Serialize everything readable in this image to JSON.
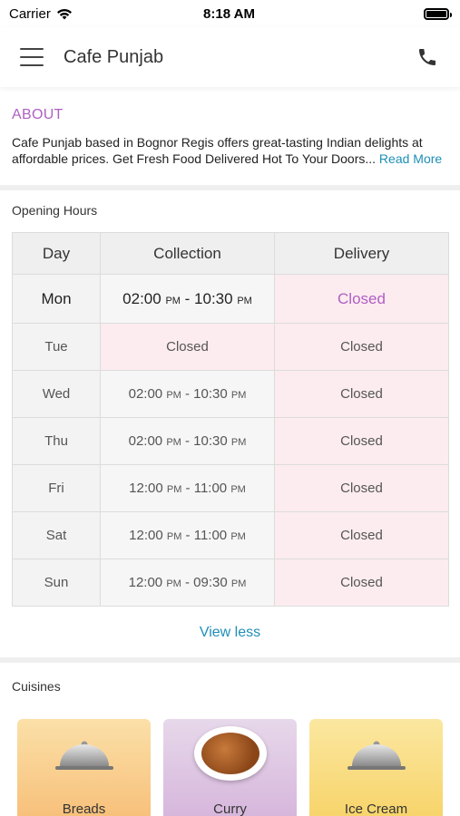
{
  "status_bar": {
    "carrier": "Carrier",
    "time": "8:18 AM"
  },
  "header": {
    "title": "Cafe Punjab"
  },
  "about": {
    "title": "ABOUT",
    "text_line1": "Cafe Punjab based in Bognor Regis offers great-tasting Indian delights at",
    "text_line2": "affordable prices. Get Fresh Food Delivered Hot To Your Doors...",
    "read_more": "Read More"
  },
  "hours": {
    "title": "Opening Hours",
    "columns": [
      "Day",
      "Collection",
      "Delivery"
    ],
    "rows": [
      {
        "day": "Mon",
        "collection": "02:00 PM - 10:30 PM",
        "c_start": "02:00",
        "c_end": "10:30",
        "c_closed": false,
        "delivery": "Closed",
        "today": true
      },
      {
        "day": "Tue",
        "collection": "Closed",
        "c_closed": true,
        "delivery": "Closed"
      },
      {
        "day": "Wed",
        "collection": "02:00 PM - 10:30 PM",
        "c_start": "02:00",
        "c_end": "10:30",
        "c_closed": false,
        "delivery": "Closed"
      },
      {
        "day": "Thu",
        "collection": "02:00 PM - 10:30 PM",
        "c_start": "02:00",
        "c_end": "10:30",
        "c_closed": false,
        "delivery": "Closed"
      },
      {
        "day": "Fri",
        "collection": "12:00 PM - 11:00 PM",
        "c_start": "12:00",
        "c_end": "11:00",
        "c_closed": false,
        "delivery": "Closed"
      },
      {
        "day": "Sat",
        "collection": "12:00 PM - 11:00 PM",
        "c_start": "12:00",
        "c_end": "11:00",
        "c_closed": false,
        "delivery": "Closed"
      },
      {
        "day": "Sun",
        "collection": "12:00 PM - 09:30 PM",
        "c_start": "12:00",
        "c_end": "09:30",
        "c_closed": false,
        "delivery": "Closed"
      }
    ],
    "ampm": "PM",
    "view_less": "View less"
  },
  "cuisines": {
    "title": "Cuisines",
    "items": [
      {
        "label": "Breads",
        "icon": "cloche-icon",
        "bg_top": "#fbe0a8",
        "bg_bottom": "#f7c07a"
      },
      {
        "label": "Curry",
        "icon": "curry-dish-image",
        "bg_top": "#e7d8ea",
        "bg_bottom": "#d6b6dc"
      },
      {
        "label": "Ice Cream",
        "icon": "cloche-icon",
        "bg_top": "#fbe7a0",
        "bg_bottom": "#f7d46a"
      }
    ]
  },
  "colors": {
    "accent_purple": "#b05fc4",
    "link_blue": "#1e8fb8",
    "closed_bg": "#fcecef"
  }
}
